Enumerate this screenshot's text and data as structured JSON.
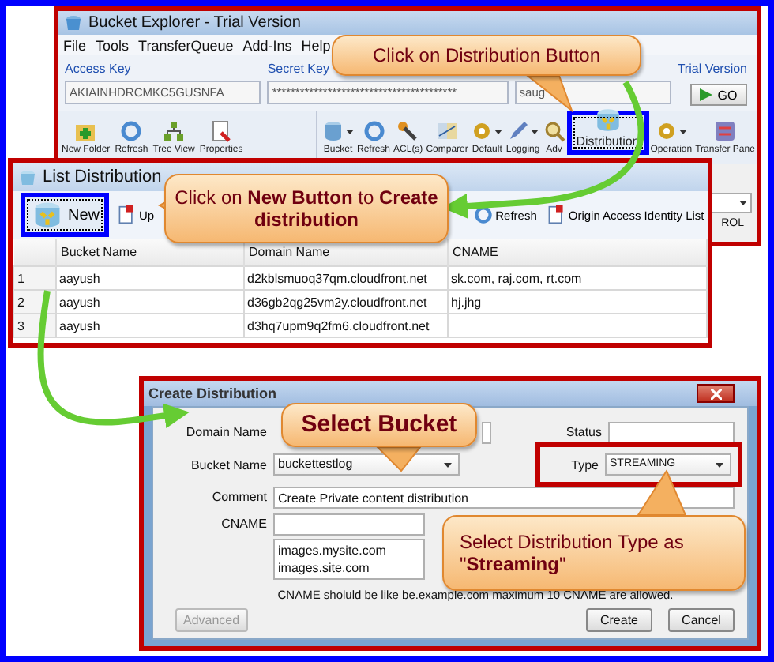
{
  "main_window": {
    "title": "Bucket Explorer - Trial Version",
    "menu": [
      "File",
      "Tools",
      "TransferQueue",
      "Add-Ins",
      "Help"
    ],
    "access_key": {
      "label": "Access Key",
      "value": "AKIAINHDRCMKC5GUSNFA"
    },
    "secret_key": {
      "label": "Secret Key",
      "value": "****************************************"
    },
    "field_3": {
      "value": "saug"
    },
    "trial_label": "Trial Version",
    "go_button": "GO",
    "left_toolbar": [
      {
        "label": "New Folder"
      },
      {
        "label": "Refresh"
      },
      {
        "label": "Tree View"
      },
      {
        "label": "Properties"
      }
    ],
    "right_toolbar": [
      {
        "label": "Bucket",
        "dropdown": true,
        "highlighted": false
      },
      {
        "label": "Refresh",
        "dropdown": false,
        "highlighted": false
      },
      {
        "label": "ACL(s)",
        "dropdown": false,
        "highlighted": false
      },
      {
        "label": "Comparer",
        "dropdown": false,
        "highlighted": false
      },
      {
        "label": "Default",
        "dropdown": true,
        "highlighted": false
      },
      {
        "label": "Logging",
        "dropdown": true,
        "highlighted": false
      },
      {
        "label": "Adv",
        "dropdown": false,
        "highlighted": false
      },
      {
        "label": "Distribution",
        "dropdown": false,
        "highlighted": true
      },
      {
        "label": "Operation",
        "dropdown": true,
        "highlighted": false
      },
      {
        "label": "Transfer Pane",
        "dropdown": false,
        "highlighted": false
      }
    ],
    "fragment": "ROL"
  },
  "list_window": {
    "title": "List Distribution",
    "toolbar": [
      {
        "label": "New",
        "highlighted": true
      },
      {
        "label": "Up",
        "highlighted": false
      },
      {
        "label": "Refresh",
        "highlighted": false
      },
      {
        "label": "Origin Access Identity List",
        "highlighted": false
      }
    ],
    "columns": [
      "Bucket Name",
      "Domain Name",
      "CNAME"
    ],
    "rows": [
      {
        "index": "1",
        "bucket": "aayush",
        "domain": "d2kblsmuoq37qm.cloudfront.net",
        "cname": "sk.com, raj.com, rt.com"
      },
      {
        "index": "2",
        "bucket": "aayush",
        "domain": "d36gb2qg25vm2y.cloudfront.net",
        "cname": "hj.jhg"
      },
      {
        "index": "3",
        "bucket": "aayush",
        "domain": "d3hq7upm9q2fm6.cloudfront.net",
        "cname": ""
      }
    ]
  },
  "dialog": {
    "title": "Create Distribution",
    "domain_name": {
      "label": "Domain Name"
    },
    "status": {
      "label": "Status"
    },
    "bucket_name": {
      "label": "Bucket Name",
      "value": "buckettestlog"
    },
    "type": {
      "label": "Type",
      "value": "STREAMING",
      "highlighted": true
    },
    "comment": {
      "label": "Comment",
      "value": "Create Private content distribution"
    },
    "cname": {
      "label": "CNAME",
      "list": [
        "images.mysite.com",
        "images.site.com"
      ]
    },
    "hint": "CNAME sholuld be like be.example.com maximum  10 CNAME are allowed.",
    "advanced_button": {
      "label": "Advanced",
      "disabled": true
    },
    "create_button": "Create",
    "cancel_button": "Cancel"
  },
  "callouts": [
    {
      "text": "Click on Distribution Button"
    },
    {
      "text": "Click on **New Button** to **Create distribution**"
    },
    {
      "text": "**Select Bucket**"
    },
    {
      "text": "Select Distribution Type as \"**Streaming**\""
    }
  ]
}
